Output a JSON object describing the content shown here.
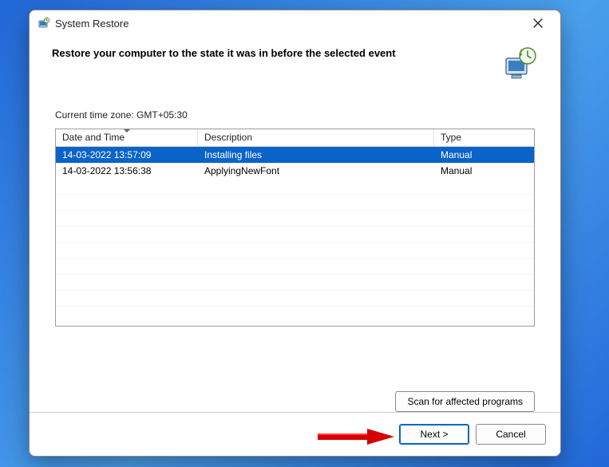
{
  "titlebar": {
    "title": "System Restore"
  },
  "header": {
    "heading": "Restore your computer to the state it was in before the selected event"
  },
  "content": {
    "timezone_label": "Current time zone: GMT+05:30",
    "columns": {
      "date": "Date and Time",
      "desc": "Description",
      "type": "Type"
    },
    "rows": [
      {
        "date": "14-03-2022 13:57:09",
        "desc": "Installing files",
        "type": "Manual",
        "selected": true
      },
      {
        "date": "14-03-2022 13:56:38",
        "desc": "ApplyingNewFont",
        "type": "Manual",
        "selected": false
      }
    ],
    "scan_button": "Scan for affected programs"
  },
  "footer": {
    "next": "Next >",
    "cancel": "Cancel"
  }
}
